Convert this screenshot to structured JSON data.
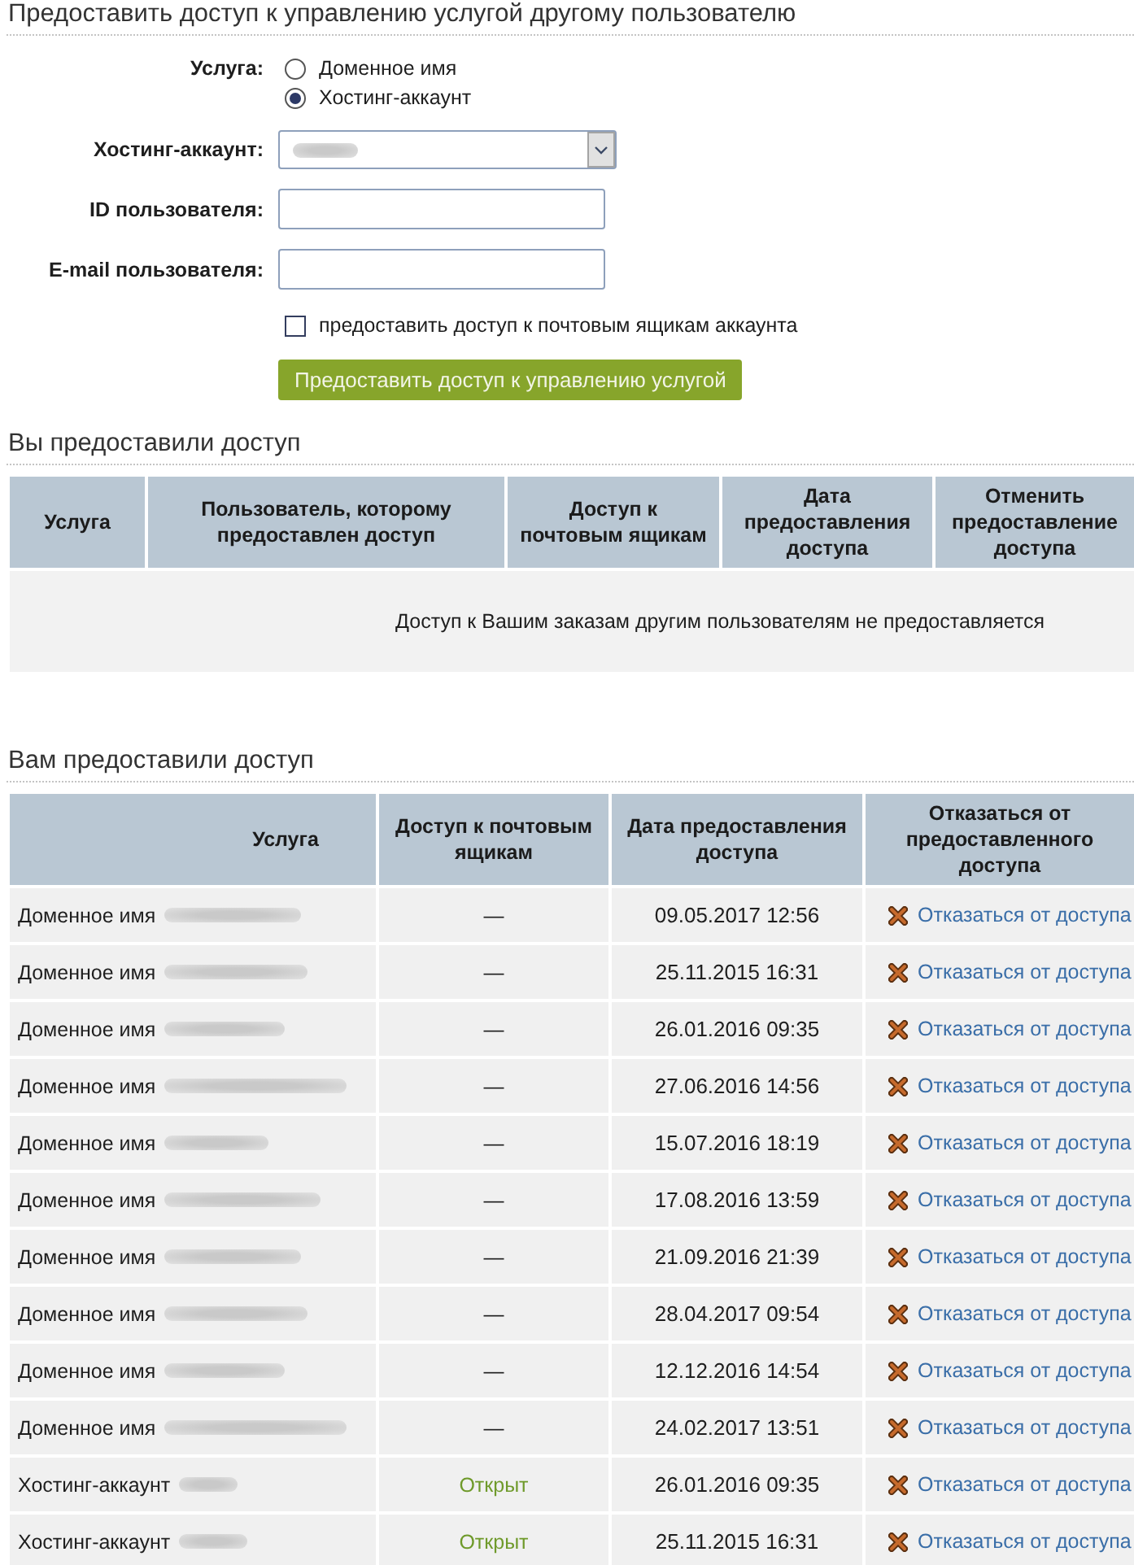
{
  "form": {
    "title": "Предоставить доступ к управлению услугой другому пользователю",
    "service": {
      "label": "Услуга:",
      "options": [
        {
          "label": "Доменное имя",
          "selected": false
        },
        {
          "label": "Хостинг-аккаунт",
          "selected": true
        }
      ]
    },
    "hosting_account": {
      "label": "Хостинг-аккаунт:"
    },
    "user_id": {
      "label": "ID пользователя:"
    },
    "user_email": {
      "label": "E-mail пользователя:"
    },
    "mailbox_access": {
      "label": "предоставить доступ к почтовым ящикам аккаунта",
      "checked": false
    },
    "submit_button": "Предоставить доступ к управлению услугой"
  },
  "granted_by_you": {
    "title": "Вы предоставили доступ",
    "columns": [
      "Услуга",
      "Пользователь, которому предоставлен доступ",
      "Доступ к почтовым ящикам",
      "Дата предоставления доступа",
      "Отменить предоставление доступа"
    ],
    "empty_message": "Доступ к Вашим заказам другим пользователям не предоставляется"
  },
  "granted_to_you": {
    "title": "Вам предоставили доступ",
    "columns": [
      "Услуга",
      "Доступ к почтовым ящикам",
      "Дата предоставления доступа",
      "Отказаться от предоставленного доступа"
    ],
    "rows": [
      {
        "service": "Доменное имя",
        "mail_access": "—",
        "mail_open": false,
        "date": "09.05.2017 12:56",
        "action": "Отказаться от доступа"
      },
      {
        "service": "Доменное имя",
        "mail_access": "—",
        "mail_open": false,
        "date": "25.11.2015 16:31",
        "action": "Отказаться от доступа"
      },
      {
        "service": "Доменное имя",
        "mail_access": "—",
        "mail_open": false,
        "date": "26.01.2016 09:35",
        "action": "Отказаться от доступа"
      },
      {
        "service": "Доменное имя",
        "mail_access": "—",
        "mail_open": false,
        "date": "27.06.2016 14:56",
        "action": "Отказаться от доступа"
      },
      {
        "service": "Доменное имя",
        "mail_access": "—",
        "mail_open": false,
        "date": "15.07.2016 18:19",
        "action": "Отказаться от доступа"
      },
      {
        "service": "Доменное имя",
        "mail_access": "—",
        "mail_open": false,
        "date": "17.08.2016 13:59",
        "action": "Отказаться от доступа"
      },
      {
        "service": "Доменное имя",
        "mail_access": "—",
        "mail_open": false,
        "date": "21.09.2016 21:39",
        "action": "Отказаться от доступа"
      },
      {
        "service": "Доменное имя",
        "mail_access": "—",
        "mail_open": false,
        "date": "28.04.2017 09:54",
        "action": "Отказаться от доступа"
      },
      {
        "service": "Доменное имя",
        "mail_access": "—",
        "mail_open": false,
        "date": "12.12.2016 14:54",
        "action": "Отказаться от доступа"
      },
      {
        "service": "Доменное имя",
        "mail_access": "—",
        "mail_open": false,
        "date": "24.02.2017 13:51",
        "action": "Отказаться от доступа"
      },
      {
        "service": "Хостинг-аккаунт",
        "mail_access": "Открыт",
        "mail_open": true,
        "date": "26.01.2016 09:35",
        "action": "Отказаться от доступа"
      },
      {
        "service": "Хостинг-аккаунт",
        "mail_access": "Открыт",
        "mail_open": true,
        "date": "25.11.2015 16:31",
        "action": "Отказаться от доступа"
      }
    ]
  }
}
